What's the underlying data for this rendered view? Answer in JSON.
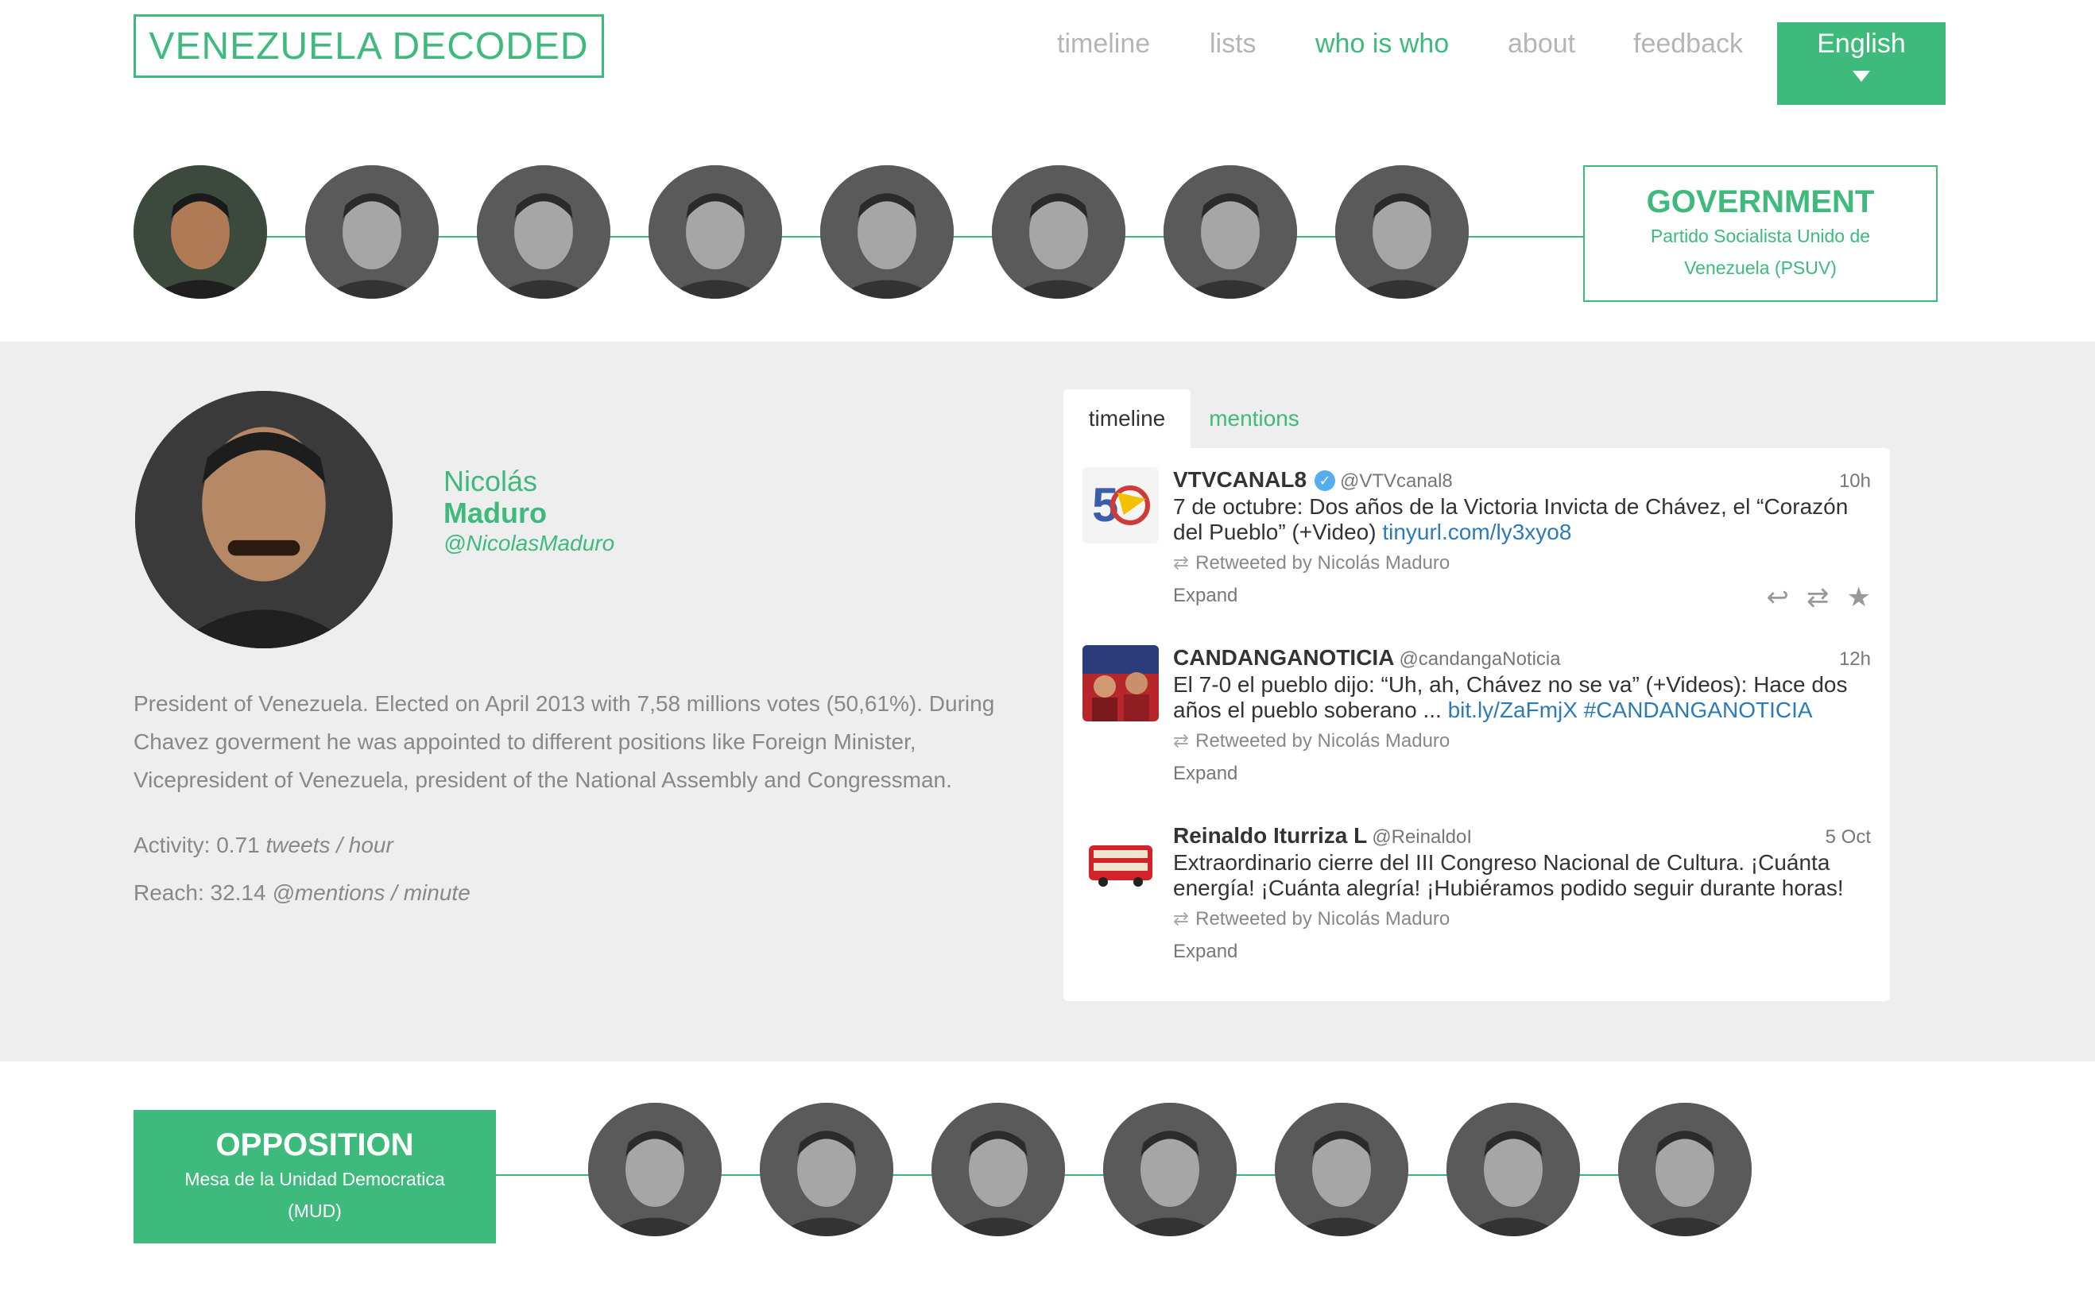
{
  "header": {
    "logo": "VENEZUELA DECODED",
    "nav": [
      {
        "label": "timeline",
        "active": false
      },
      {
        "label": "lists",
        "active": false
      },
      {
        "label": "who is who",
        "active": true
      },
      {
        "label": "about",
        "active": false
      },
      {
        "label": "feedback",
        "active": false
      }
    ],
    "language": "English"
  },
  "government": {
    "title": "GOVERNMENT",
    "subtitle": "Partido Socialista Unido de Venezuela (PSUV)",
    "member_count": 8
  },
  "profile": {
    "first_name": "Nicolás",
    "last_name": "Maduro",
    "handle": "@NicolasMaduro",
    "bio": "President of Venezuela. Elected on April 2013 with 7,58 millions votes (50,61%). During Chavez goverment he was appointed to different positions like Foreign Minister, Vicepresident of Venezuela, president of the National Assembly and Congressman.",
    "activity_label": "Activity: 0.71",
    "activity_unit": "tweets / hour",
    "reach_label": "Reach: 32.14",
    "reach_unit": "@mentions / minute"
  },
  "feed": {
    "tabs": [
      "timeline",
      "mentions"
    ],
    "active_tab": "timeline",
    "tweets": [
      {
        "author": "VTVCANAL8",
        "screen_name": "@VTVcanal8",
        "verified": true,
        "time": "10h",
        "text": "7 de octubre: Dos años de la Victoria Invicta de Chávez, el “Corazón del Pueblo” (+Video)",
        "link": "tinyurl.com/ly3xyo8",
        "retweeted_by": "Retweeted by Nicolás Maduro",
        "expand": "Expand"
      },
      {
        "author": "CANDANGANOTICIA",
        "screen_name": "@candangaNoticia",
        "verified": false,
        "time": "12h",
        "text": "El 7-0 el pueblo dijo: “Uh, ah, Chávez no se va” (+Videos): Hace dos años el pueblo soberano ...",
        "link": "bit.ly/ZaFmjX #CANDANGANOTICIA",
        "retweeted_by": "Retweeted by Nicolás Maduro",
        "expand": "Expand"
      },
      {
        "author": "Reinaldo Iturriza L",
        "screen_name": "@ReinaldoI",
        "verified": false,
        "time": "5 Oct",
        "text": "Extraordinario cierre del III Congreso Nacional de Cultura. ¡Cuánta energía! ¡Cuánta alegría! ¡Hubiéramos podido seguir durante horas!",
        "link": "",
        "retweeted_by": "Retweeted by Nicolás Maduro",
        "expand": "Expand"
      }
    ]
  },
  "opposition": {
    "title": "OPPOSITION",
    "subtitle": "Mesa de la Unidad Democratica (MUD)",
    "member_count": 7
  },
  "colors": {
    "accent": "#3dba7c",
    "band": "#eeeeee",
    "link": "#2b7bb9"
  }
}
